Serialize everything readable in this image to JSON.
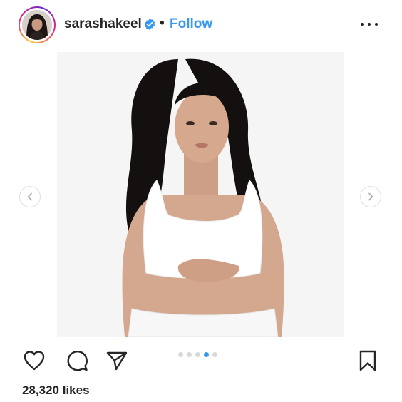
{
  "header": {
    "username": "sarashakeel",
    "separator": "•",
    "follow_label": "Follow"
  },
  "icons": {
    "verified": "verified-badge-icon",
    "more": "more-options-icon",
    "prev": "chevron-left-icon",
    "next": "chevron-right-icon",
    "like": "heart-icon",
    "comment": "comment-icon",
    "share": "paper-plane-icon",
    "save": "bookmark-icon"
  },
  "carousel": {
    "total_slides": 5,
    "active_slide": 4
  },
  "post": {
    "likes": "28,320 likes"
  },
  "colors": {
    "accent": "#3897f0",
    "text": "#262626",
    "dot_inactive": "#d9d9d9"
  }
}
